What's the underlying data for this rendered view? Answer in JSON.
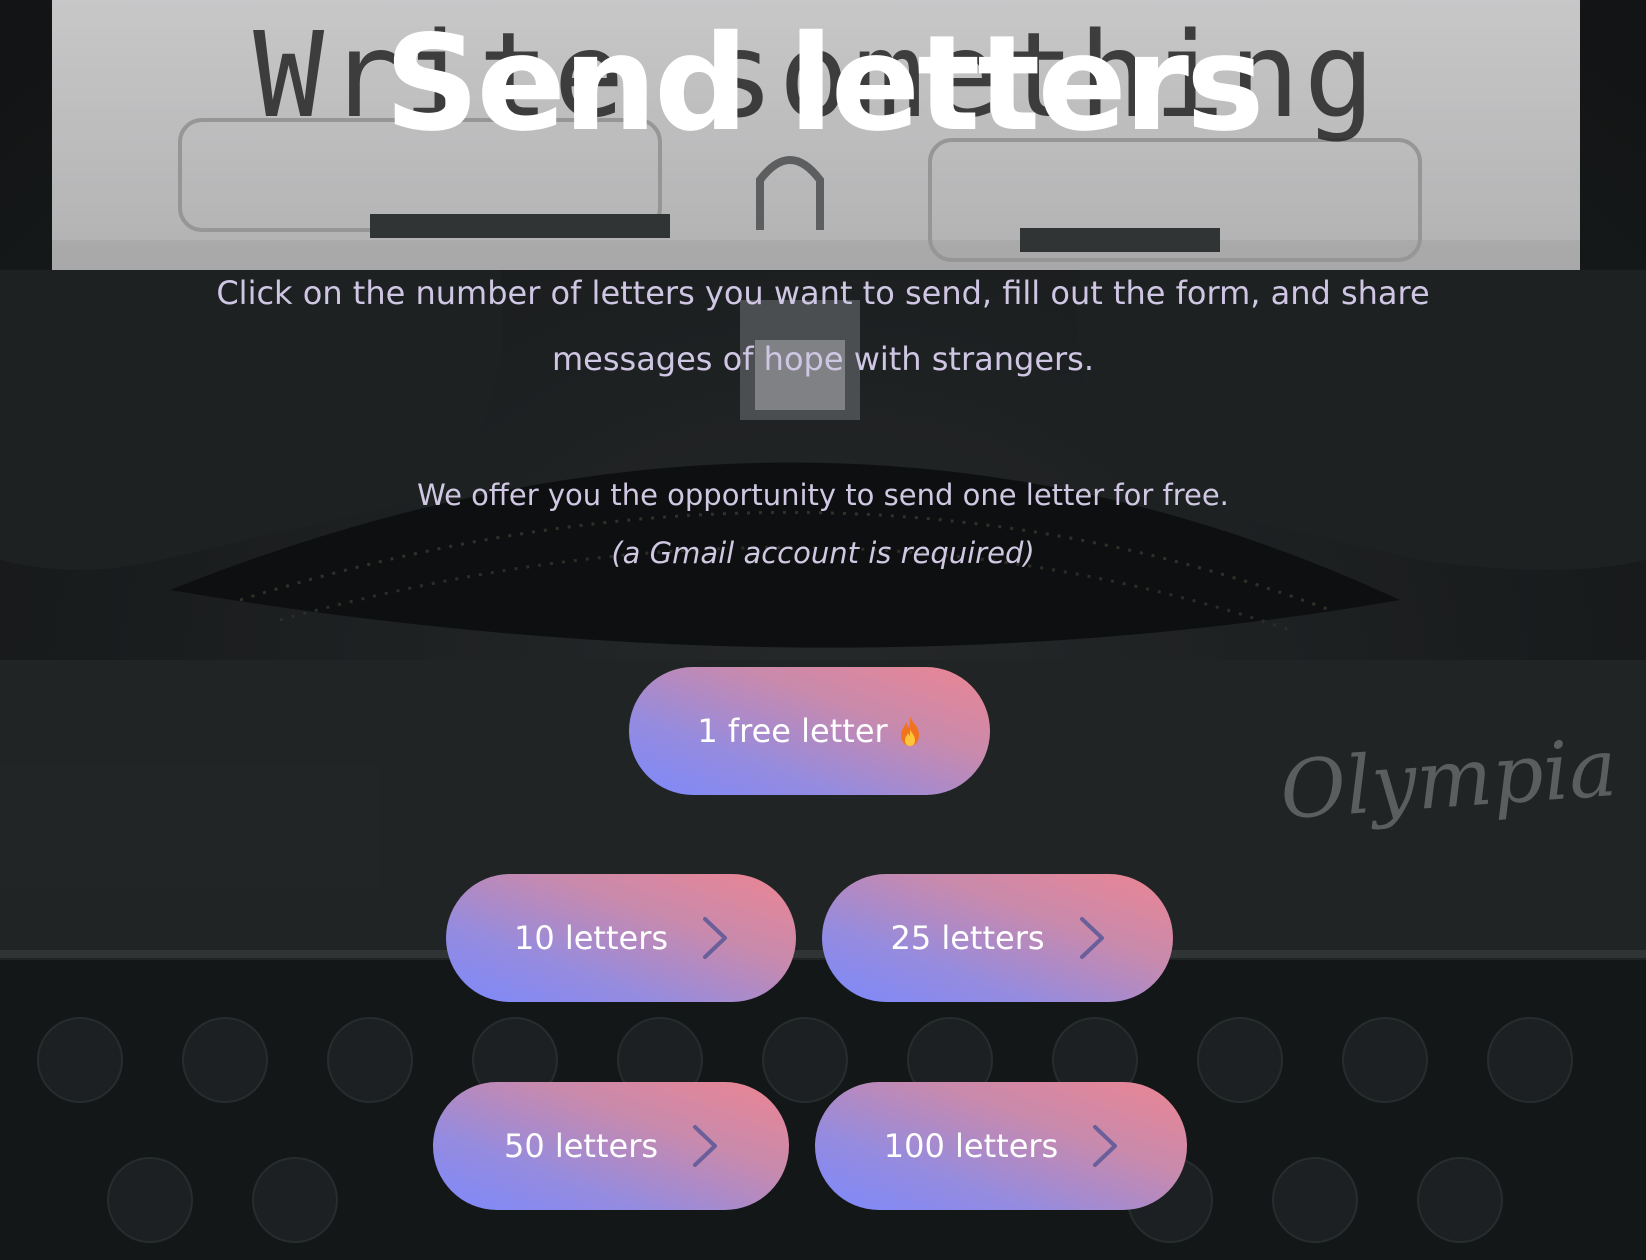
{
  "page": {
    "title": "Send letters",
    "subtitle": "Click on the number of letters you want to send, fill out the form, and share messages of hope with strangers.",
    "offer_text": "We offer you the opportunity to send one letter for free.",
    "offer_note": "(a Gmail account is required)"
  },
  "background": {
    "paper_text": "Write something",
    "brand_text": "Olympia"
  },
  "buttons": {
    "free": {
      "label": "1 free letter",
      "icon": "fire-icon"
    },
    "ten": {
      "label": "10 letters",
      "icon": "chevron-right-icon"
    },
    "twentyfive": {
      "label": "25 letters",
      "icon": "chevron-right-icon"
    },
    "fifty": {
      "label": "50 letters",
      "icon": "chevron-right-icon"
    },
    "hundred": {
      "label": "100 letters",
      "icon": "chevron-right-icon"
    }
  },
  "colors": {
    "button_gradient_start": "#7d89fb",
    "button_gradient_end": "#ec8592",
    "title": "#ffffff",
    "body_text": "#d0c8e2"
  }
}
